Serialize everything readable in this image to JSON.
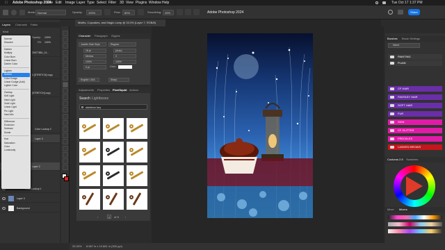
{
  "menubar": {
    "apple": "",
    "items": [
      "Adobe Photoshop 2024",
      "File",
      "Edit",
      "Image",
      "Layer",
      "Type",
      "Select",
      "Filter",
      "3D",
      "View",
      "Plugins",
      "Window",
      "Help"
    ],
    "datetime": "Tue Oct 17  1:37 PM"
  },
  "options": {
    "app_title": "Adobe Photoshop 2024",
    "mode_label": "Mode:",
    "mode_value": "Normal",
    "opacity_label": "Opacity:",
    "opacity_value": "100%",
    "flow_label": "Flow:",
    "flow_value": "80%",
    "smoothing_label": "Smoothing:",
    "smoothing_value": "49%",
    "share": "Share"
  },
  "doc_tab": "Misfits, Cupcakes, and Magic Lamp @ 33.3% (Layer 7, RGB/8)",
  "layers_panel": {
    "tabs": [
      "Layers",
      "Channels",
      "Paths"
    ],
    "kind_label": "Kind",
    "opacity_label": "Opacity:",
    "opacity_value": "100%",
    "fill_label": "Fill:",
    "fill_value": "100%",
    "rows": [
      "20077881_01...",
      "4 [STRETCH] copy",
      "[STRETCH] copy",
      "Color Lookup 2",
      "Layer 3",
      "Layer 2",
      "Color Lookup 1",
      "Layer 3",
      "Background"
    ]
  },
  "blend_menu": {
    "groups": [
      [
        "Normal",
        "Dissolve"
      ],
      [
        "Darken",
        "Multiply",
        "Color Burn",
        "Linear Burn",
        "Darker Color"
      ],
      [
        "Lighten",
        "Screen",
        "Color Dodge",
        "Linear Dodge (Add)",
        "Lighter Color"
      ],
      [
        "Overlay",
        "Soft Light",
        "Hard Light",
        "Vivid Light",
        "Linear Light",
        "Pin Light",
        "Hard Mix"
      ],
      [
        "Difference",
        "Exclusion",
        "Subtract",
        "Divide"
      ],
      [
        "Hue",
        "Saturation",
        "Color",
        "Luminosity"
      ]
    ],
    "selected": "Screen"
  },
  "character_panel": {
    "tabs": [
      "Character",
      "Paragraph",
      "Glyphs"
    ],
    "font_family": "Josefin Slab Style",
    "font_style": "Regular",
    "size": "18 pt",
    "leading": "(Auto)",
    "tracking": "Metrics",
    "kerning": "0",
    "vscale": "100%",
    "hscale": "100%",
    "baseline": "0 pt",
    "color_label": "Color:",
    "language": "English: USA",
    "aa": "Sharp"
  },
  "pixel_panel": {
    "tabs": [
      "Adjustments",
      "Properties",
      "PixelSquid",
      "Actions"
    ],
    "search_label": "Search",
    "search_source": "Lightboxes",
    "search_query": "skeleton key",
    "page": "1",
    "page_total": "of 8"
  },
  "brushes_panel": {
    "tabs": [
      "Brushes",
      "Brush Settings"
    ],
    "search_placeholder": "Name",
    "folders": [
      {
        "name": "PAINTING",
        "color": "#3a3a3a"
      },
      {
        "name": "PLAIN",
        "color": "#3a3a3a"
      },
      {
        "name": "CF HAIR",
        "color": "#6a2ea8"
      },
      {
        "name": "FANTASY HAIR",
        "color": "#6a2ea8"
      },
      {
        "name": "SOFT HAIR",
        "color": "#6a2ea8"
      },
      {
        "name": "FUR",
        "color": "#6a2ea8"
      },
      {
        "name": "SKIN",
        "color": "#e21aa8"
      },
      {
        "name": "CF GLITTER",
        "color": "#e21aa8"
      },
      {
        "name": "FRECKLES",
        "color": "#e21aa8"
      },
      {
        "name": "LASHES/ BROWS",
        "color": "#c4161c"
      }
    ]
  },
  "coolorus": {
    "tabs": [
      "Coolorus 2.5",
      "Swatches"
    ],
    "bottom_tabs": [
      "Mixer",
      "Mixers"
    ]
  },
  "status": {
    "zoom": "33.33%",
    "size": "8.567 in x 10.681 in (300 ppi)"
  },
  "colors": {
    "accent": "#1473e6",
    "selection": "#2680eb",
    "purple": "#6a2ea8",
    "magenta": "#e21aa8",
    "red": "#c4161c"
  }
}
